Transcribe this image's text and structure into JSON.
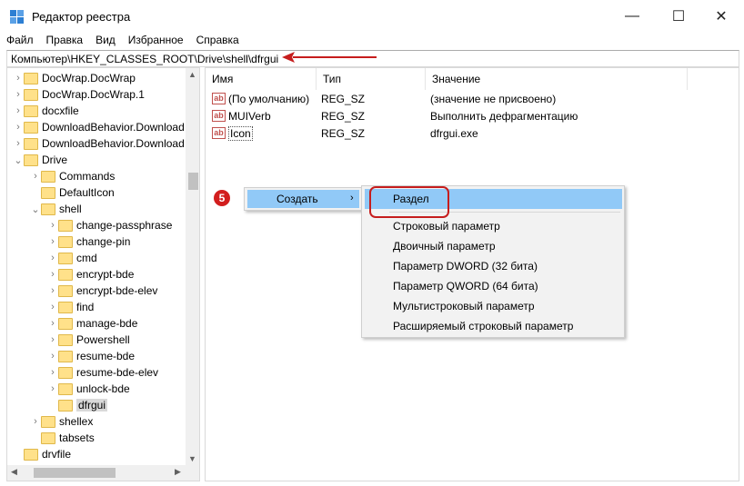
{
  "window": {
    "title": "Редактор реестра",
    "controls": {
      "minimize": "—",
      "maximize": "☐",
      "close": "✕"
    }
  },
  "menu": [
    "Файл",
    "Правка",
    "Вид",
    "Избранное",
    "Справка"
  ],
  "address": "Компьютер\\HKEY_CLASSES_ROOT\\Drive\\shell\\dfrgui",
  "tree": [
    {
      "label": "DocWrap.DocWrap",
      "chev": "›"
    },
    {
      "label": "DocWrap.DocWrap.1",
      "chev": "›"
    },
    {
      "label": "docxfile",
      "chev": "›"
    },
    {
      "label": "DownloadBehavior.Download",
      "chev": "›"
    },
    {
      "label": "DownloadBehavior.Download",
      "chev": "›"
    },
    {
      "label": "Drive",
      "chev": "⌄"
    },
    {
      "label": "Commands",
      "chev": "›"
    },
    {
      "label": "DefaultIcon",
      "chev": ""
    },
    {
      "label": "shell",
      "chev": "⌄"
    },
    {
      "label": "change-passphrase",
      "chev": "›"
    },
    {
      "label": "change-pin",
      "chev": "›"
    },
    {
      "label": "cmd",
      "chev": "›"
    },
    {
      "label": "encrypt-bde",
      "chev": "›"
    },
    {
      "label": "encrypt-bde-elev",
      "chev": "›"
    },
    {
      "label": "find",
      "chev": "›"
    },
    {
      "label": "manage-bde",
      "chev": "›"
    },
    {
      "label": "Powershell",
      "chev": "›"
    },
    {
      "label": "resume-bde",
      "chev": "›"
    },
    {
      "label": "resume-bde-elev",
      "chev": "›"
    },
    {
      "label": "unlock-bde",
      "chev": "›"
    },
    {
      "label": "dfrgui",
      "chev": ""
    },
    {
      "label": "shellex",
      "chev": "›"
    },
    {
      "label": "tabsets",
      "chev": ""
    },
    {
      "label": "drvfile",
      "chev": ""
    }
  ],
  "columns": {
    "name": "Имя",
    "type": "Тип",
    "value": "Значение"
  },
  "rows": [
    {
      "name": "(По умолчанию)",
      "type": "REG_SZ",
      "value": "(значение не присвоено)",
      "icon": "ab"
    },
    {
      "name": "MUIVerb",
      "type": "REG_SZ",
      "value": "Выполнить дефрагментацию",
      "icon": "ab"
    },
    {
      "name": "Icon",
      "type": "REG_SZ",
      "value": "dfrgui.exe",
      "icon": "ab"
    }
  ],
  "context_menu": {
    "create": "Создать",
    "arrow": "›"
  },
  "badge": "5",
  "submenu": [
    "Раздел",
    "Строковый параметр",
    "Двоичный параметр",
    "Параметр DWORD (32 бита)",
    "Параметр QWORD (64 бита)",
    "Мультистроковый параметр",
    "Расширяемый строковый параметр"
  ],
  "colors": {
    "highlight": "#91c9f7",
    "annotation_red": "#c61d1d"
  }
}
